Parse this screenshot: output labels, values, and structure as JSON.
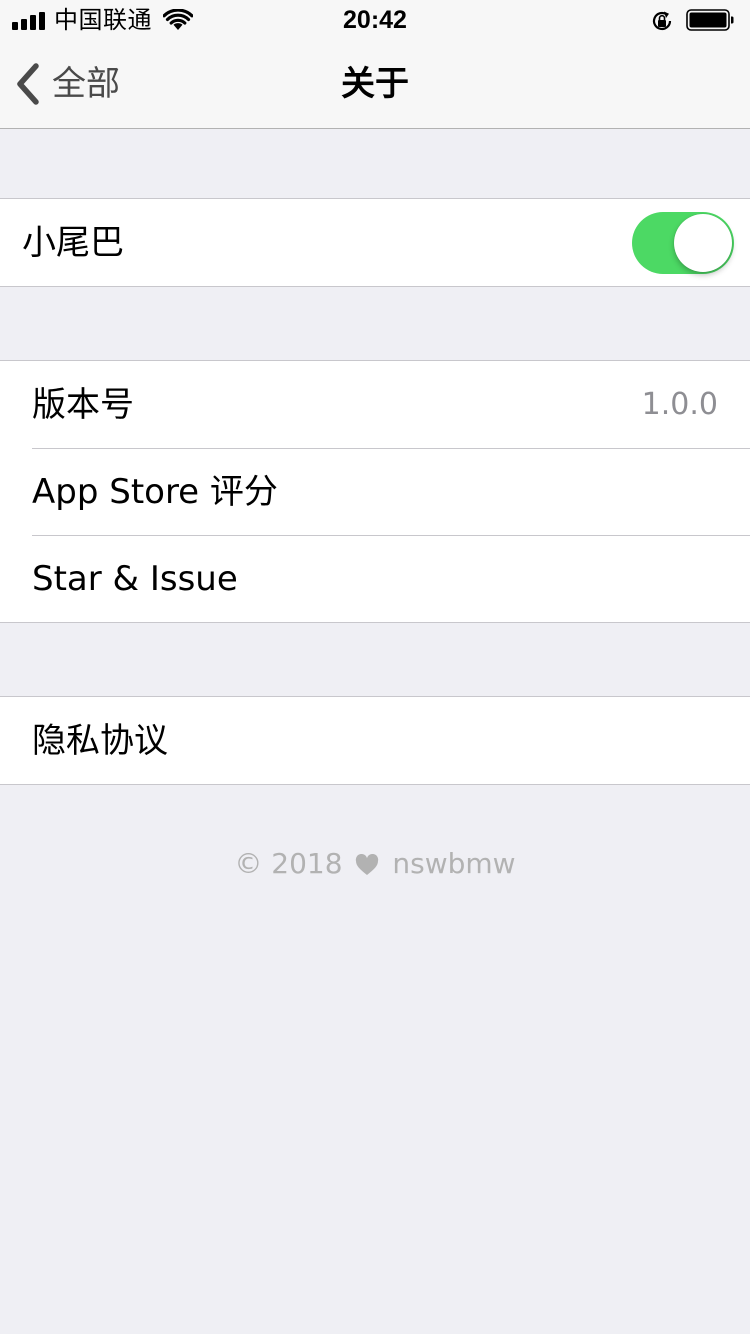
{
  "status_bar": {
    "carrier": "中国联通",
    "time": "20:42",
    "signal_icon": "cellular-signal-icon",
    "wifi_icon": "wifi-icon",
    "orientation_lock_icon": "orientation-lock-icon",
    "battery_icon": "battery-icon"
  },
  "nav": {
    "back_label": "全部",
    "back_icon": "chevron-left-icon",
    "title": "关于"
  },
  "settings": {
    "tail": {
      "label": "小尾巴",
      "enabled": true
    },
    "about_items": [
      {
        "label": "版本号",
        "value": "1.0.0"
      },
      {
        "label": "App Store 评分"
      },
      {
        "label": "Star & Issue"
      }
    ],
    "privacy": {
      "label": "隐私协议"
    }
  },
  "footer": {
    "copyright": "© 2018",
    "heart_icon": "heart-icon",
    "author": "nswbmw"
  },
  "colors": {
    "background": "#efeff4",
    "toggle_on": "#4cd964",
    "secondary_text": "#8e8e93",
    "footer_text": "#b2b2b2"
  }
}
